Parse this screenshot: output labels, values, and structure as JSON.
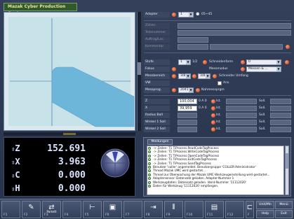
{
  "app": {
    "title": "Mazak Cyber Production Center"
  },
  "form": {
    "adapter": {
      "label": "Adapter",
      "value": "1",
      "extra": "05~45"
    },
    "rows_dim": [
      {
        "label": "Zähler"
      },
      {
        "label": "Teilenummer"
      },
      {
        "label": "Auftrag/Los"
      },
      {
        "label": "Kommentar"
      }
    ],
    "stufe": {
      "label": "Stufe",
      "value": "1",
      "extra": "1/2"
    },
    "schneidenform": {
      "label": "Schneidenform",
      "value": "0"
    },
    "fokus": {
      "label": "Fokus"
    },
    "messmodus": {
      "label": "Messmodus",
      "value": "Messen & ..."
    },
    "messbereich": {
      "label": "Messbereich",
      "value1": "3/8",
      "value2": "3/8"
    },
    "schneider_umfang": {
      "label": "Schneider Umfang"
    },
    "vw": {
      "label": "VW",
      "check_label": "Ans."
    },
    "messprog": {
      "label": "Messprog.",
      "value": "2041",
      "extra": "Nahmessprgm"
    },
    "coords": [
      {
        "label": "Z",
        "value": "100,004",
        "mid": "0 A 0",
        "ist": "Ist.",
        "soll": "Soll."
      },
      {
        "label": "X",
        "value": "39,959",
        "mid": "0 A 0",
        "ist": "Ist.",
        "soll": "Soll."
      },
      {
        "label": "Radius Ball",
        "value": "",
        "mid": "",
        "ist": "Ist.",
        "soll": "Soll."
      },
      {
        "label": "Winkel 1 Soll",
        "value": "",
        "mid": "",
        "ist": "Ist.",
        "soll": "Soll."
      },
      {
        "label": "Winkel 2 Soll",
        "value": "",
        "mid": "",
        "ist": "Ist.",
        "soll": "Soll."
      }
    ]
  },
  "dro": {
    "rows": [
      {
        "axis": "Z",
        "value": "152.691"
      },
      {
        "axis": "X",
        "value": "3.963"
      },
      {
        "axis": "C",
        "value": "0.000"
      },
      {
        "axis": "H",
        "value": "0.000"
      }
    ]
  },
  "messages": {
    "tab": "Meldungen",
    "items": [
      "-> Zeilen: T1 TiProcess.ReadCodeTagProcess",
      "-> Zeilen: T1 TiProcess.WriteCodeTagProcess",
      "-> Zeilen: T1 TiProcess.OpenCodeTagProcess",
      "-> Zeilen: T1 TiProcess.ExitCodeTagProcess",
      "-> Zeilen: T1 TiProcess.SendTagProcess",
      "Benutzer 'coller' angemeldet. Benutzergruppe 'COLLER-Administrator'",
      "Thread Mazak UMC wird gestartet...",
      "Thread zur Überwachung der Mazak UMC-Werkzeugeinstellung wird gestartet...",
      "Adaptersensor: Datensatz geladen. Adapter-Nummer 1",
      "Werkzeugdaten: Datensatz geladen. Ident-Nummer '11112020'",
      "Daten für Werkzeug '11112020' empfangen."
    ]
  },
  "fkeys": [
    {
      "label": "F1",
      "sub": "",
      "glyph": ""
    },
    {
      "label": "F2",
      "sub": "",
      "glyph": "✎"
    },
    {
      "label": "F3",
      "sub": "Parkett",
      "glyph": "⇄"
    },
    {
      "label": "F4",
      "sub": "",
      "glyph": ""
    },
    {
      "label": "F5",
      "sub": "",
      "glyph": "⊢"
    },
    {
      "label": "F6",
      "sub": "",
      "glyph": "▣"
    },
    {
      "label": "F7",
      "sub": "",
      "glyph": ""
    },
    {
      "label": "F8",
      "sub": "",
      "glyph": "⇥"
    },
    {
      "label": "F9",
      "sub": "",
      "glyph": "⫴"
    },
    {
      "label": "F10",
      "sub": "",
      "glyph": ""
    },
    {
      "label": "F11",
      "sub": "",
      "glyph": "▤"
    },
    {
      "label": "F12",
      "sub": "",
      "glyph": ""
    },
    {
      "label": "F",
      "sub": "",
      "glyph": "⊏"
    }
  ],
  "right_buttons": {
    "unit": "Unit/Mn",
    "menu": "Menü",
    "help": "Help",
    "exit": "Exit"
  },
  "colors": {
    "accent": "#6eb5da",
    "bullet": "#d9532a",
    "dro_text": "#dce4ff"
  }
}
